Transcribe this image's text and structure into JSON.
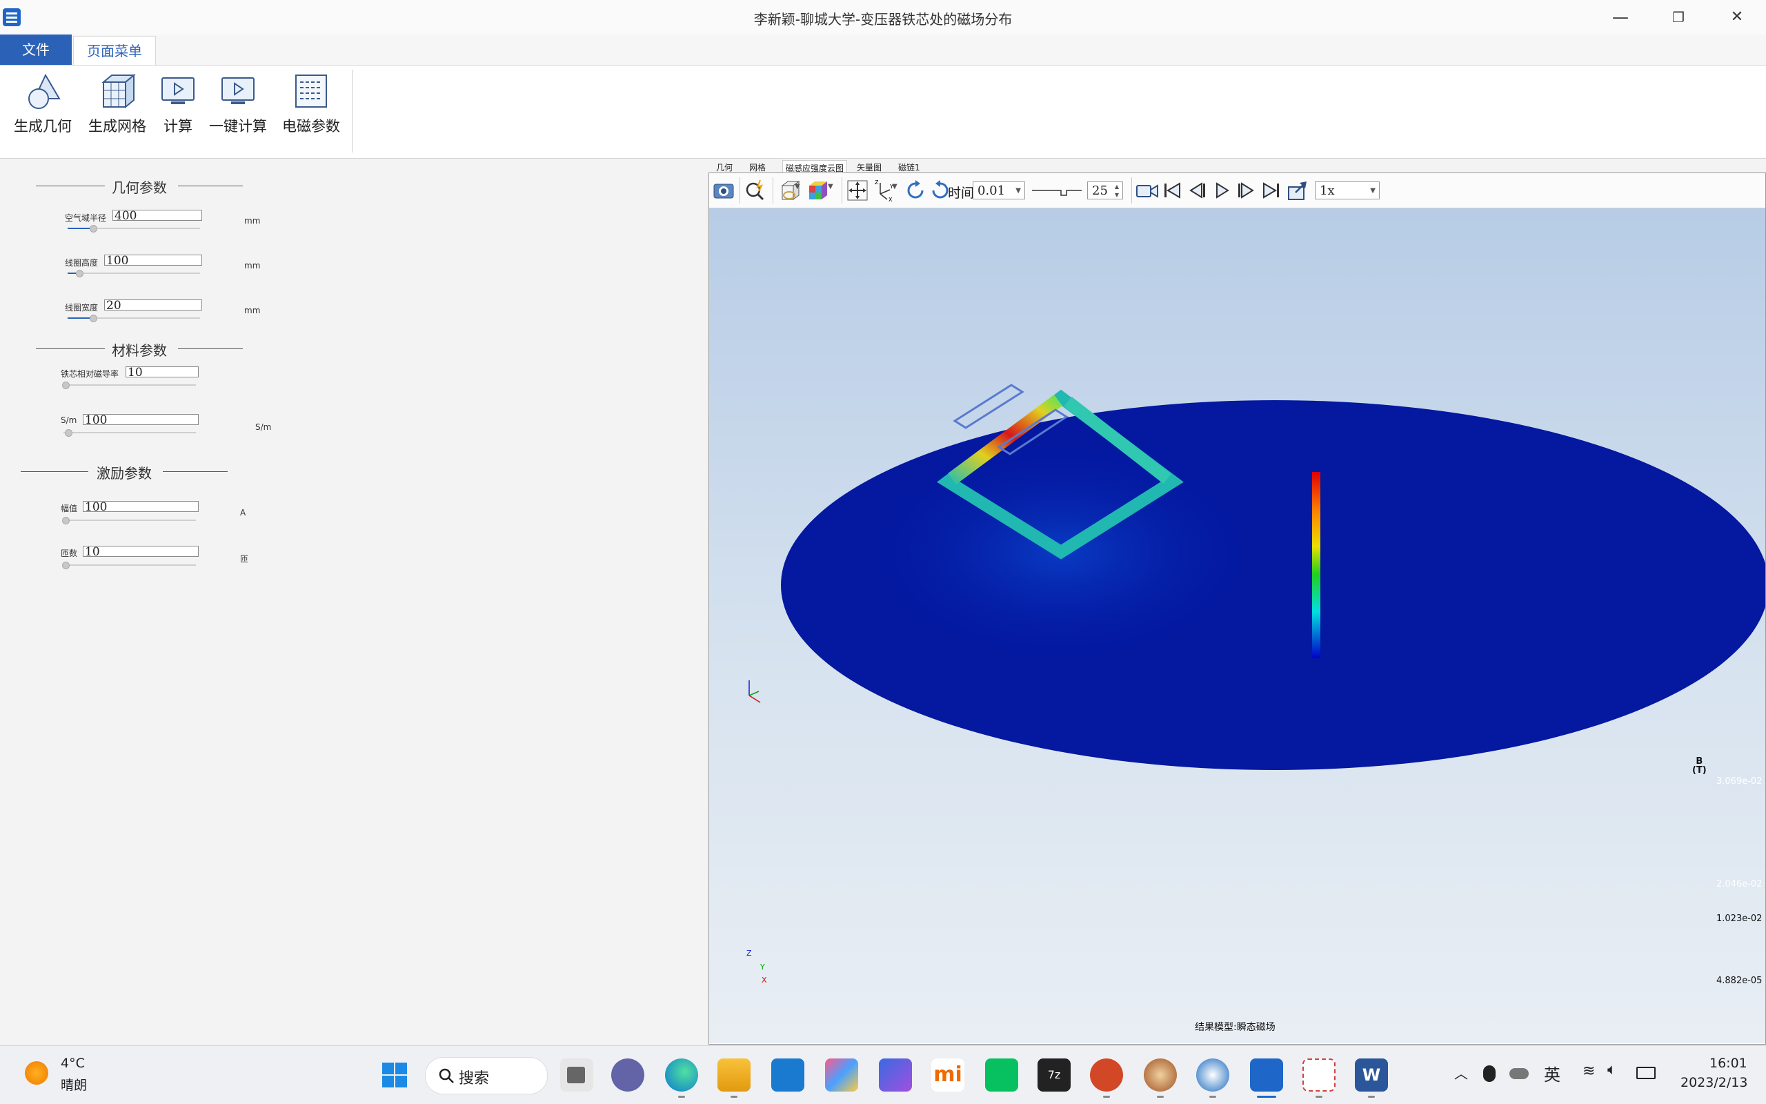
{
  "window": {
    "title": "李新颖-聊城大学-变压器铁芯处的磁场分布",
    "minimize": "—",
    "restore": "❐",
    "close": "✕"
  },
  "ribbon": {
    "tabs": [
      "文件",
      "页面菜单"
    ],
    "buttons": [
      {
        "label": "生成几何",
        "icon": "geometry-icon"
      },
      {
        "label": "生成网格",
        "icon": "mesh-icon"
      },
      {
        "label": "计算",
        "icon": "compute-icon"
      },
      {
        "label": "一键计算",
        "icon": "one-click-compute-icon"
      },
      {
        "label": "电磁参数",
        "icon": "em-params-icon"
      }
    ]
  },
  "params": {
    "geometry_title": "几何参数",
    "air_radius": {
      "label": "空气域半径",
      "value": "400",
      "unit": "mm",
      "slider": 0.25
    },
    "coil_height": {
      "label": "线圈高度",
      "value": "100",
      "unit": "mm",
      "slider": 0.1
    },
    "coil_width": {
      "label": "线圈宽度",
      "value": "20",
      "unit": "mm",
      "slider": 0.2
    },
    "material_title": "材料参数",
    "core_perm": {
      "label": "铁芯相对磁导率",
      "value": "10",
      "slider": 0.0
    },
    "conductivity": {
      "label": "S/m",
      "value": "100",
      "unit": "S/m",
      "slider": 0.05
    },
    "excitation_title": "激励参数",
    "amplitude": {
      "label": "幅值",
      "value": "100",
      "unit": "A",
      "slider": 0.0
    },
    "turns": {
      "label": "匝数",
      "value": "10",
      "unit": "匝",
      "slider": 0.0
    }
  },
  "viewer": {
    "tabs": [
      "几何",
      "网格",
      "磁感应强度云图",
      "矢量图",
      "磁链1"
    ],
    "time_label": "时间",
    "time_value": "0.01",
    "frame_value": "25",
    "speed_value": "1x",
    "result_caption": "结果模型:瞬态磁场",
    "colorbar": {
      "title": "B\n(T)",
      "ticks": [
        "3.069e-02",
        "2.046e-02",
        "1.023e-02",
        "4.882e-05"
      ]
    },
    "axes": {
      "z": "Z",
      "y": "Y",
      "x": "X"
    }
  },
  "taskbar": {
    "weather_temp": "4°C",
    "weather_desc": "晴朗",
    "search_label": "搜索",
    "ime": "英",
    "time": "16:01",
    "date": "2023/2/13"
  },
  "colors": {
    "accent": "#2b62b8",
    "field_background": "#0418a0"
  }
}
